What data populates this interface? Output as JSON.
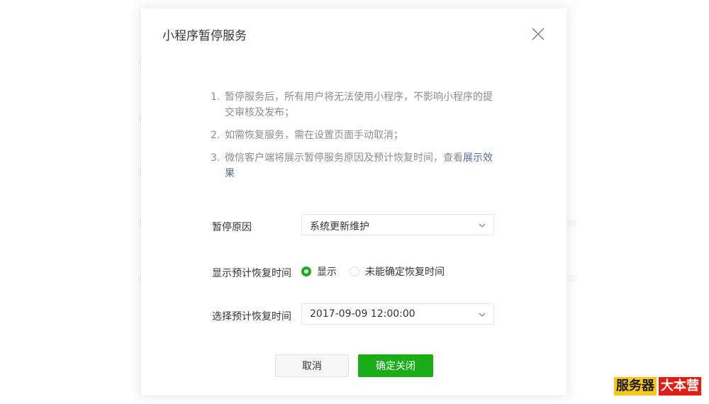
{
  "dialog": {
    "title": "小程序暂停服务",
    "close_icon": "close-icon"
  },
  "notes": [
    {
      "num": "1.",
      "text": "暂停服务后，所有用户将无法使用小程序，不影响小程序的提交审核及发布；"
    },
    {
      "num": "2.",
      "text": "如需恢复服务，需在设置页面手动取消；"
    },
    {
      "num": "3.",
      "text": "微信客户端将展示暂停服务原因及预计恢复时间，查看",
      "link": "展示效果"
    }
  ],
  "form": {
    "reason_label": "暂停原因",
    "reason_value": "系统更新维护",
    "show_time_label": "显示预计恢复时间",
    "show_option": "显示",
    "no_option": "未能确定恢复时间",
    "selected_option": "显示",
    "time_label": "选择预计恢复时间",
    "time_value": "2017-09-09 12:00:00"
  },
  "buttons": {
    "cancel": "取消",
    "confirm": "确定关闭"
  },
  "colors": {
    "accent": "#1aad19",
    "link": "#576b95",
    "muted_text": "#8d8d8d"
  },
  "watermark": {
    "part1": "服务器",
    "part2": "大本营"
  }
}
